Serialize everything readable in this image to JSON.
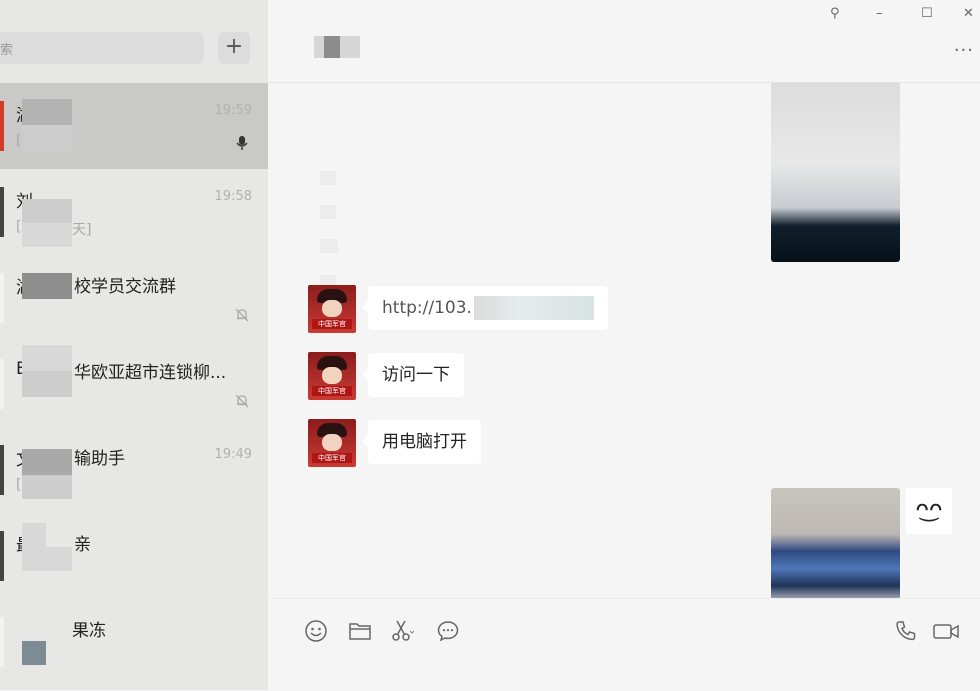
{
  "window": {
    "controls": {
      "pin": "⚲",
      "minimize": "–",
      "maximize": "☐",
      "close": "✕"
    }
  },
  "sidebar": {
    "search_placeholder": "索",
    "add_label": "+",
    "chats": [
      {
        "name_first": "湖",
        "name_rest": "",
        "preview": "[",
        "preview_rest": "",
        "time": "19:59",
        "indicator": "mic"
      },
      {
        "name_first": "刘",
        "name_rest": "",
        "preview": "[",
        "preview_rest": "天]",
        "time": "19:58",
        "indicator": ""
      },
      {
        "name_first": "湖",
        "name_rest": "校学员交流群",
        "preview": "",
        "preview_rest": "",
        "time": "",
        "indicator": "mute"
      },
      {
        "name_first": "E",
        "name_rest": "华欧亚超市连锁柳...",
        "preview": "",
        "preview_rest": "",
        "time": "",
        "indicator": "mute"
      },
      {
        "name_first": "文",
        "name_rest": "输助手",
        "preview": "[",
        "preview_rest": "",
        "time": "19:49",
        "indicator": ""
      },
      {
        "name_first": "最",
        "name_rest": "亲",
        "preview": "",
        "preview_rest": "",
        "time": "",
        "indicator": ""
      },
      {
        "name_first": "",
        "name_rest": "果冻",
        "preview": "",
        "preview_rest": "",
        "time": "",
        "indicator": ""
      }
    ]
  },
  "chat": {
    "title": "大",
    "more_label": "···",
    "messages": [
      {
        "type": "image",
        "side": "right"
      },
      {
        "type": "text",
        "side": "left",
        "text": "http://103."
      },
      {
        "type": "text",
        "side": "left",
        "text": "访问一下"
      },
      {
        "type": "text",
        "side": "left",
        "text": "用电脑打开"
      },
      {
        "type": "image",
        "side": "right"
      }
    ],
    "avatar_tag": "中国军官",
    "sticker": "ᴖ͜ᴖ"
  },
  "toolbar": {
    "icons": [
      "emoji-icon",
      "folder-icon",
      "scissors-icon",
      "chat-history-icon",
      "phone-icon",
      "video-icon"
    ]
  }
}
